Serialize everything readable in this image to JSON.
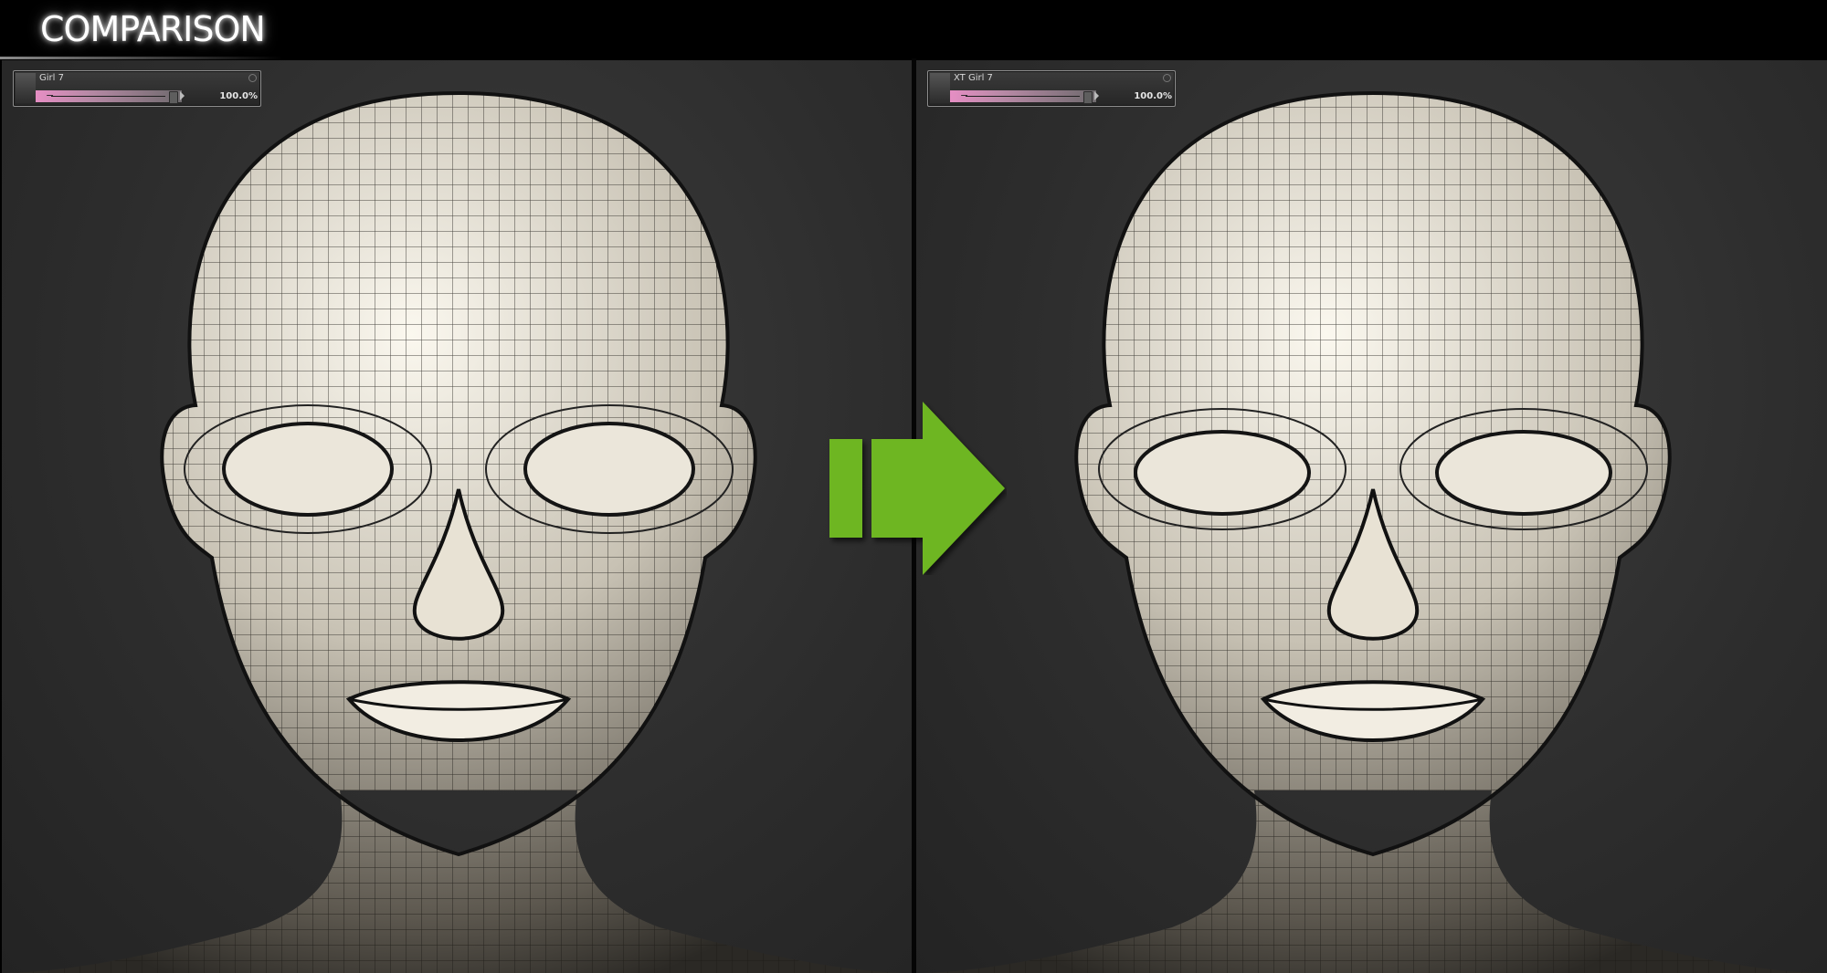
{
  "header": {
    "title": "COMPARISON"
  },
  "left_panel": {
    "morph_dial": {
      "name": "Girl 7",
      "value_label": "100.0%",
      "value": 100.0,
      "thumbnail_icon": "figure-thumbnail-icon"
    }
  },
  "right_panel": {
    "morph_dial": {
      "name": "XT Girl 7",
      "value_label": "100.0%",
      "value": 100.0,
      "thumbnail_icon": "figure-thumbnail-icon"
    }
  },
  "arrow": {
    "icon": "arrow-right-icon",
    "color": "#6eb622"
  },
  "colors": {
    "slider_pink": "#e68ec4",
    "panel_bg": "#2d2d2d",
    "header_bg": "#000000"
  }
}
